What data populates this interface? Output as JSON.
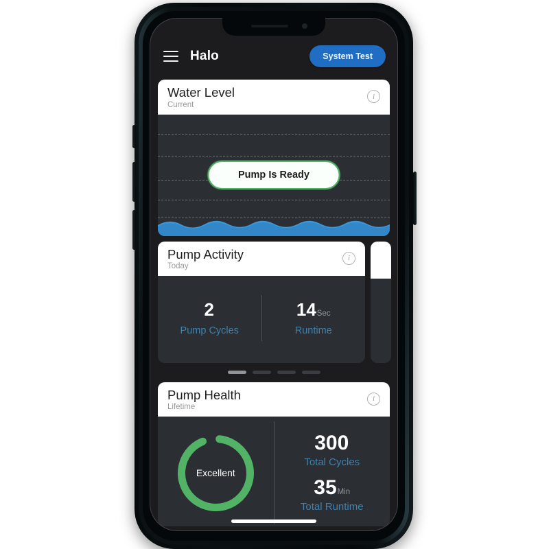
{
  "app": {
    "title": "Halo",
    "menu_icon": "hamburger-menu-icon",
    "system_test_label": "System Test",
    "accent_blue": "#1f6ec4",
    "label_blue": "#3f82b0",
    "status_green": "#52b265",
    "water_blue": "#3d97d6",
    "screen_bg": "#1c1c1e",
    "card_body_bg": "#2b2e33"
  },
  "water_level": {
    "title": "Water Level",
    "subtitle": "Current",
    "info_icon": "info-icon",
    "status_pill": "Pump Is Ready",
    "gridline_count": 5,
    "water_fill_level_pct": 14
  },
  "pump_activity": {
    "title": "Pump Activity",
    "subtitle": "Today",
    "info_icon": "info-icon",
    "stats": [
      {
        "value": "2",
        "unit": "",
        "label": "Pump Cycles"
      },
      {
        "value": "14",
        "unit": "Sec",
        "label": "Runtime"
      }
    ]
  },
  "carousel": {
    "dot_count": 4,
    "active_index": 0
  },
  "pump_health": {
    "title": "Pump Health",
    "subtitle": "Lifetime",
    "info_icon": "info-icon",
    "rating": "Excellent",
    "ring_color": "#52b265",
    "ring_progress_pct": 92,
    "stats": [
      {
        "value": "300",
        "unit": "",
        "label": "Total Cycles"
      },
      {
        "value": "35",
        "unit": "Min",
        "label": "Total Runtime"
      }
    ]
  }
}
